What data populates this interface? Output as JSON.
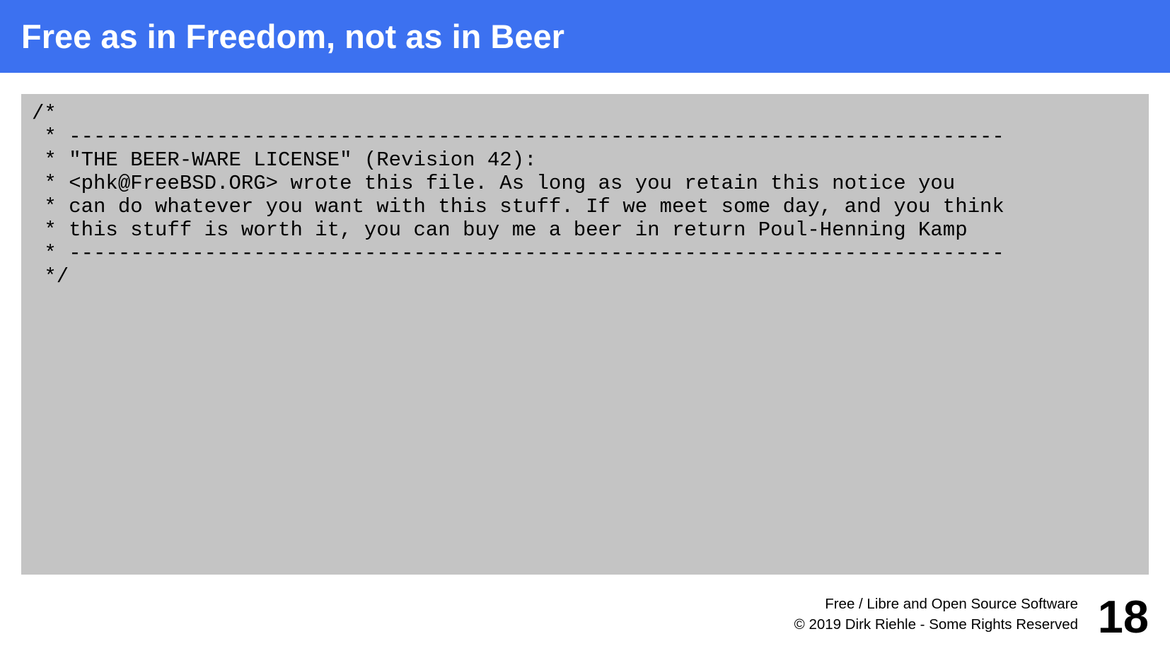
{
  "slide": {
    "title": "Free as in Freedom, not as in Beer",
    "code_lines": [
      "/*",
      " * ----------------------------------------------------------------------------",
      " * \"THE BEER-WARE LICENSE\" (Revision 42):",
      " * <phk@FreeBSD.ORG> wrote this file. As long as you retain this notice you",
      " * can do whatever you want with this stuff. If we meet some day, and you think",
      " * this stuff is worth it, you can buy me a beer in return Poul-Henning Kamp",
      " * ----------------------------------------------------------------------------",
      " */"
    ],
    "footer": {
      "course": "Free / Libre and Open Source Software",
      "copyright": "© 2019 Dirk Riehle - Some Rights Reserved"
    },
    "page_number": "18"
  },
  "colors": {
    "title_bar": "#3c71f0",
    "code_background": "#c4c4c4",
    "title_text": "#ffffff"
  }
}
